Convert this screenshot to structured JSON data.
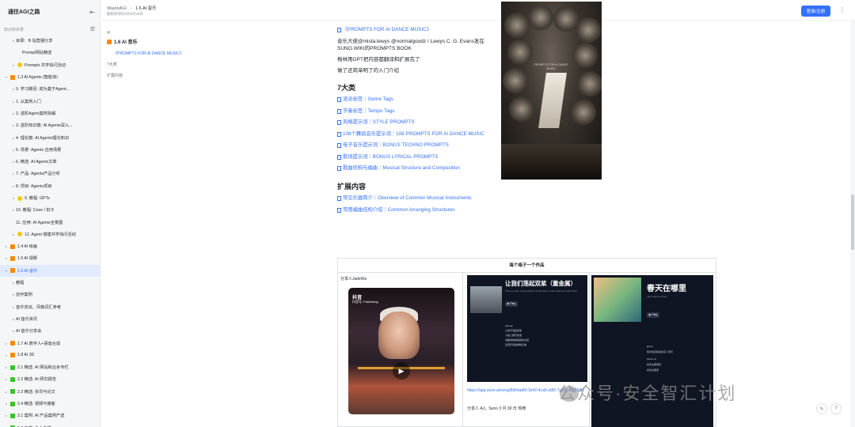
{
  "sidebar": {
    "title": "通往AGI之路",
    "subtitle": "知识库目录",
    "items": [
      {
        "label": "目录：B 站直播分享",
        "level": 2,
        "icon": "doc",
        "arrow": "▸"
      },
      {
        "label": "Prompt网站精选",
        "level": 3,
        "icon": "doc",
        "arrow": ""
      },
      {
        "label": "Prompts 共学快闪活动",
        "level": 2,
        "icon": "emoji",
        "arrow": "▸"
      },
      {
        "label": "1.3 AI Agents (智能体)",
        "level": 1,
        "icon": "orange",
        "arrow": "▾"
      },
      {
        "label": "0. 学习路径: 成为基于Agent...",
        "level": 2,
        "icon": "doc",
        "arrow": "▸"
      },
      {
        "label": "1. 从案例入门",
        "level": 2,
        "icon": "doc",
        "arrow": "▸"
      },
      {
        "label": "2. 进阶Agent案例拆解",
        "level": 2,
        "icon": "doc",
        "arrow": "▸"
      },
      {
        "label": "3. 进阶知识篇: AI Agents深入...",
        "level": 2,
        "icon": "doc",
        "arrow": "▸"
      },
      {
        "label": "4. 理论篇: AI Agents理论知识",
        "level": 2,
        "icon": "doc",
        "arrow": "▸"
      },
      {
        "label": "5. 场景: Agents 应用场景",
        "level": 2,
        "icon": "doc",
        "arrow": "▸"
      },
      {
        "label": "6. 精选: AI Agents文章",
        "level": 2,
        "icon": "doc",
        "arrow": "▸"
      },
      {
        "label": "7. 产品: Agents产品分析",
        "level": 2,
        "icon": "doc",
        "arrow": "▸"
      },
      {
        "label": "8. 项目: Agents项目",
        "level": 2,
        "icon": "doc",
        "arrow": "▸"
      },
      {
        "label": "9. 教程: GPTs",
        "level": 2,
        "icon": "emoji",
        "arrow": "▸"
      },
      {
        "label": "10. 教程: Coze / 扣子",
        "level": 2,
        "icon": "doc",
        "arrow": "▸"
      },
      {
        "label": "11. 应用: AI Agents全景图",
        "level": 2,
        "icon": "doc",
        "arrow": ""
      },
      {
        "label": "12. Agent 搭建共学快闪活动",
        "level": 2,
        "icon": "emoji",
        "arrow": "▸"
      },
      {
        "label": "1.4 AI 绘画",
        "level": 1,
        "icon": "orange",
        "arrow": "▸"
      },
      {
        "label": "1.5 AI 视频",
        "level": 1,
        "icon": "orange",
        "arrow": "▸"
      },
      {
        "label": "1.6 AI 音乐",
        "level": 1,
        "icon": "orange",
        "arrow": "▾",
        "active": true
      },
      {
        "label": "教程",
        "level": 2,
        "icon": "doc",
        "arrow": "▸"
      },
      {
        "label": "创作案例",
        "level": 2,
        "icon": "doc",
        "arrow": "▸"
      },
      {
        "label": "音乐流派、风格词汇参考",
        "level": 2,
        "icon": "doc",
        "arrow": "▸"
      },
      {
        "label": "AI 音乐资讯",
        "level": 2,
        "icon": "doc",
        "arrow": "▸"
      },
      {
        "label": "AI 音乐分享会",
        "level": 2,
        "icon": "doc",
        "arrow": "▸"
      },
      {
        "label": "1.7 AI 数字人+语音合成",
        "level": 1,
        "icon": "orange",
        "arrow": "▸"
      },
      {
        "label": "1.8 AI 3D",
        "level": 1,
        "icon": "orange",
        "arrow": "▸"
      },
      {
        "label": "2.1 精选: AI 网站和业余专栏",
        "level": 1,
        "icon": "green",
        "arrow": "▸"
      },
      {
        "label": "2.2 精选: AI 研究报告",
        "level": 1,
        "icon": "green",
        "arrow": "▸"
      },
      {
        "label": "2.3 精选: 资讯与论文",
        "level": 1,
        "icon": "green",
        "arrow": "▸"
      },
      {
        "label": "2.4 精选: 视频与播客",
        "level": 1,
        "icon": "green",
        "arrow": "▸"
      },
      {
        "label": "3.1 案例: AI 产品案例产选",
        "level": 1,
        "icon": "green",
        "arrow": "▸"
      },
      {
        "label": "3.2 专栏: 个人专栏",
        "level": 1,
        "icon": "green",
        "arrow": "▸"
      }
    ]
  },
  "topbar": {
    "breadcrumb": [
      "WaytoAGI",
      "1.6 AI 音乐"
    ],
    "edit_time": "最新修改时间为6月29日",
    "login_label": "登录/注册"
  },
  "outline": {
    "title": "1.6 AI 音乐",
    "items": [
      "《PROMPTS FOR AI DANCE MUSIC》",
      "7大类",
      "扩展内容"
    ]
  },
  "doc": {
    "top_link": "《PROMPTS FOR AI DANCE MUSIC》",
    "para1": "音乐大佬@mista.lewys @normalgoodz / Lewys C. G. Evans发在SUNO.WIKI的PROMPTS BOOK",
    "para2": "格林用GPT把内容都翻译和扩展完了",
    "para3": "做了还简单明了的入门介绍",
    "heading1": "7大类",
    "categories": [
      "流派标签｜Genre Tags",
      "节奏标签｜Tempo Tags",
      "风格提示词｜STYLE PROMPTS",
      "108个舞蹈音乐提示词｜108 PROMPTS FOR AI DANCE MUSIC",
      "电子音乐提示词｜BONUS TECHNO PROMPTS",
      "歌词提示词｜BONUS LYRICAL PROMPTS",
      "歌曲结构与编曲｜Musical Structure and Composition"
    ],
    "heading2": "扩展内容",
    "extensions": [
      "常见乐器简介｜Overview of Common Musical Instruments",
      "常用编曲结构介绍｜Common Arranging Structures"
    ],
    "cover_text": "PROMPTS FOR AI DANCE MUSIC"
  },
  "gallery": {
    "title": "每个格子一个作品",
    "sharer": "分享人JadeWu",
    "tiktok": {
      "logo": "抖音",
      "id": "抖音号: Publicblog"
    },
    "suno1": {
      "title": "让我们荡起双桨（重金属）",
      "tags": "Chinese Folk, Heavy Metal, Choral Metal, Improvisational Jazz Rock",
      "play": "▶ Play",
      "lyrics": [
        "[Verse]",
        "让我们荡起双桨",
        "小船儿推开波浪",
        "海面倒映着美丽的白塔",
        "四周环绕着绿树红墙"
      ]
    },
    "suno2": {
      "title": "春天在哪里",
      "tags": "Jazz Hiphop, Blues",
      "play": "▶ Play",
      "lyrics": [
        "[Intro]",
        "我们的花我就在写了春天",
        "[Verse 1]",
        "春天在那里呀",
        "春天在那里"
      ]
    },
    "suno_link": "https://app.suno.ai/song/8d54ad5f-1b42-4ca5-a9f2-7c815450893b/",
    "suno_caption": "分享人 AJ，Suno 3 月 30 日 热榜"
  },
  "watermark": "公众号·安全智汇计划",
  "colors": {
    "accent": "#3370ff",
    "active_bg": "#e1eaff",
    "orange": "#ff8800",
    "green": "#34c724"
  }
}
